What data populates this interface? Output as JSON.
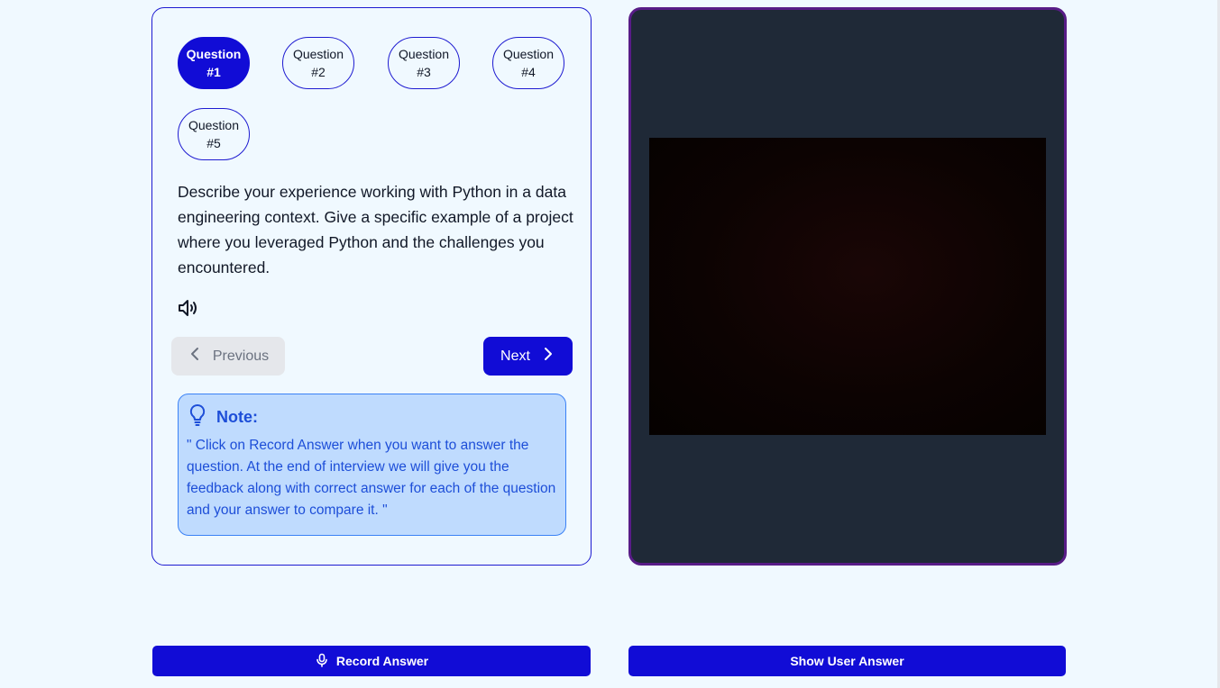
{
  "questions": {
    "tabs": [
      {
        "label": "Question",
        "number": "#1",
        "active": true
      },
      {
        "label": "Question",
        "number": "#2",
        "active": false
      },
      {
        "label": "Question",
        "number": "#3",
        "active": false
      },
      {
        "label": "Question",
        "number": "#4",
        "active": false
      },
      {
        "label": "Question",
        "number": "#5",
        "active": false
      }
    ],
    "current_text": "Describe your experience working with Python in a data engineering context. Give a specific example of a project where you leveraged Python and the challenges you encountered."
  },
  "navigation": {
    "previous_label": "Previous",
    "next_label": "Next"
  },
  "note": {
    "title": "Note:",
    "text": "\" Click on Record Answer when you want to answer the question. At the end of interview we will give you the feedback along with correct answer for each of the question and your answer to compare it. \""
  },
  "actions": {
    "record_label": "Record Answer",
    "show_label": "Show User Answer"
  },
  "colors": {
    "accent": "#110cd6",
    "camera_border": "#581c87",
    "camera_bg": "#1f2937",
    "note_bg": "#bfdbfe",
    "note_text": "#1d4ed8"
  },
  "icons": {
    "speaker": "speaker-icon",
    "chevron_left": "chevron-left-icon",
    "chevron_right": "chevron-right-icon",
    "lightbulb": "lightbulb-icon",
    "microphone": "microphone-icon"
  }
}
